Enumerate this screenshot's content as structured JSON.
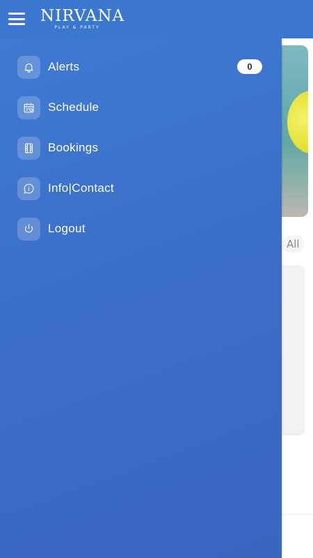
{
  "app": {
    "logo_text": "NIRVANA",
    "logo_subtitle": "PLAY & PARTY",
    "bar_color": "#3b76cf"
  },
  "background_page": {
    "filter_label": "All"
  },
  "drawer": {
    "color": "#3b6ec9",
    "items": [
      {
        "label": "Alerts",
        "icon": "bell-icon",
        "badge": "0"
      },
      {
        "label": "Schedule",
        "icon": "calendar-icon"
      },
      {
        "label": "Bookings",
        "icon": "film-icon"
      },
      {
        "label": "Info|Contact",
        "icon": "info-chat-icon"
      },
      {
        "label": "Logout",
        "icon": "power-icon"
      }
    ]
  }
}
